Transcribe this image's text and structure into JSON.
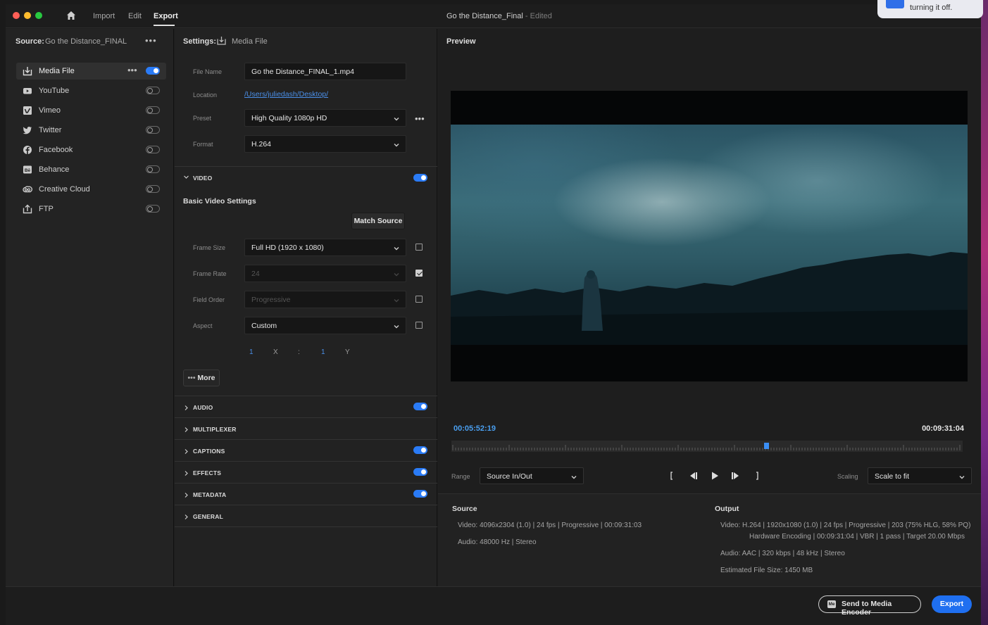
{
  "window": {
    "tabs": [
      "Import",
      "Edit",
      "Export"
    ],
    "active_tab": "Export",
    "doc_title": "Go the Distance_Final",
    "doc_status": " - Edited"
  },
  "notification": {
    "text": "turning it off."
  },
  "source": {
    "label": "Source:",
    "name": "Go the Distance_FINAL"
  },
  "destinations": [
    {
      "label": "Media File",
      "icon": "media-file-icon",
      "enabled": true
    },
    {
      "label": "YouTube",
      "icon": "youtube-icon",
      "enabled": false
    },
    {
      "label": "Vimeo",
      "icon": "vimeo-icon",
      "enabled": false
    },
    {
      "label": "Twitter",
      "icon": "twitter-icon",
      "enabled": false
    },
    {
      "label": "Facebook",
      "icon": "facebook-icon",
      "enabled": false
    },
    {
      "label": "Behance",
      "icon": "behance-icon",
      "enabled": false
    },
    {
      "label": "Creative Cloud",
      "icon": "creative-cloud-icon",
      "enabled": false
    },
    {
      "label": "FTP",
      "icon": "ftp-icon",
      "enabled": false
    }
  ],
  "settings": {
    "label": "Settings:",
    "target": "Media File",
    "file_name_label": "File Name",
    "file_name": "Go the Distance_FINAL_1.mp4",
    "location_label": "Location",
    "location": "/Users/juliedash/Desktop/",
    "preset_label": "Preset",
    "preset": "High Quality 1080p HD",
    "format_label": "Format",
    "format": "H.264"
  },
  "video": {
    "section": "VIDEO",
    "enabled": true,
    "basic_title": "Basic Video Settings",
    "match_source": "Match Source",
    "frame_size_label": "Frame Size",
    "frame_size": "Full HD (1920 x 1080)",
    "frame_size_checked": false,
    "frame_rate_label": "Frame Rate",
    "frame_rate": "24",
    "frame_rate_checked": true,
    "field_order_label": "Field Order",
    "field_order": "Progressive",
    "field_order_checked": false,
    "aspect_label": "Aspect",
    "aspect": "Custom",
    "aspect_checked": false,
    "aspect_x": "1",
    "aspect_x_label": "X",
    "aspect_sep": ":",
    "aspect_y": "1",
    "aspect_y_label": "Y",
    "more": "More"
  },
  "sections": [
    {
      "title": "AUDIO",
      "toggle": true
    },
    {
      "title": "MULTIPLEXER",
      "toggle": null
    },
    {
      "title": "CAPTIONS",
      "toggle": true
    },
    {
      "title": "EFFECTS",
      "toggle": true
    },
    {
      "title": "METADATA",
      "toggle": true
    },
    {
      "title": "GENERAL",
      "toggle": null
    }
  ],
  "preview": {
    "label": "Preview",
    "timecode_in": "00:05:52:19",
    "duration": "00:09:31:04",
    "playhead_fraction": 0.617,
    "range_label": "Range",
    "range": "Source In/Out",
    "scaling_label": "Scaling",
    "scaling": "Scale to fit"
  },
  "source_info": {
    "title": "Source",
    "video": "Video:   4096x2304 (1.0)  |  24 fps  |  Progressive  |  00:09:31:03",
    "audio": "Audio:   48000 Hz  |  Stereo"
  },
  "output_info": {
    "title": "Output",
    "video1": "Video:   H.264  |  1920x1080 (1.0)  |  24 fps  |  Progressive  |  203 (75% HLG, 58% PQ)",
    "video2": "Hardware Encoding  |  00:09:31:04  |  VBR  |  1 pass  |  Target 20.00 Mbps",
    "audio": "Audio:   AAC  |  320 kbps  |  48 kHz  |  Stereo",
    "size": "Estimated File Size:   1450 MB"
  },
  "footer": {
    "send_label": "Send to Media Encoder",
    "send_icon_text": "Me",
    "export_label": "Export"
  },
  "colors": {
    "accent": "#1f6ff0",
    "toggle_on": "#2a7bf6",
    "link": "#4a8fe8"
  }
}
